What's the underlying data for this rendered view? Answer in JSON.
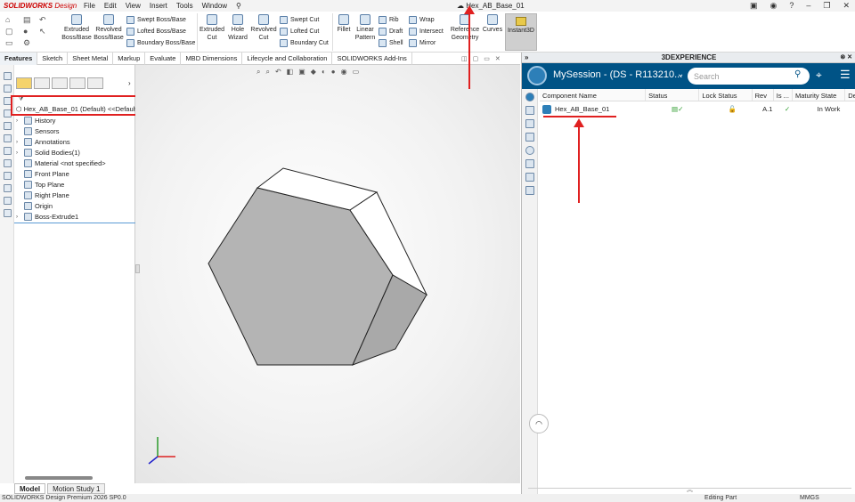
{
  "app": {
    "brand_bold": "SOLIDWORKS",
    "brand_light": "Design",
    "menus": [
      "File",
      "Edit",
      "View",
      "Insert",
      "Tools",
      "Window"
    ],
    "document_title": "Hex_AB_Base_01"
  },
  "commands": {
    "extruded_boss": "Extruded\nBoss/Base",
    "revolved_boss": "Revolved\nBoss/Base",
    "swept_boss": "Swept Boss/Base",
    "lofted_boss": "Lofted Boss/Base",
    "boundary_boss": "Boundary Boss/Base",
    "extruded_cut": "Extruded\nCut",
    "hole_wizard": "Hole\nWizard",
    "revolved_cut": "Revolved\nCut",
    "swept_cut": "Swept Cut",
    "lofted_cut": "Lofted Cut",
    "boundary_cut": "Boundary Cut",
    "fillet": "Fillet",
    "linear_pattern": "Linear\nPattern",
    "rib": "Rib",
    "draft": "Draft",
    "shell": "Shell",
    "wrap": "Wrap",
    "intersect": "Intersect",
    "mirror": "Mirror",
    "reference_geometry": "Reference\nGeometry",
    "curves": "Curves",
    "instant3d": "Instant3D"
  },
  "tabs": [
    "Features",
    "Sketch",
    "Sheet Metal",
    "Markup",
    "Evaluate",
    "MBD Dimensions",
    "Lifecycle and Collaboration",
    "SOLIDWORKS Add-Ins"
  ],
  "feature_tree": {
    "root": "Hex_AB_Base_01 (Default) <<Default>",
    "items": [
      {
        "label": "History",
        "expandable": true
      },
      {
        "label": "Sensors",
        "expandable": false
      },
      {
        "label": "Annotations",
        "expandable": true
      },
      {
        "label": "Solid Bodies(1)",
        "expandable": true
      },
      {
        "label": "Material <not specified>",
        "expandable": false
      },
      {
        "label": "Front Plane",
        "expandable": false
      },
      {
        "label": "Top Plane",
        "expandable": false
      },
      {
        "label": "Right Plane",
        "expandable": false
      },
      {
        "label": "Origin",
        "expandable": false
      },
      {
        "label": "Boss-Extrude1",
        "expandable": true
      }
    ]
  },
  "bottom_tabs": [
    "Model",
    "Motion Study 1"
  ],
  "status": {
    "left": "SOLIDWORKS Design Premium 2026 SP0.0",
    "mode": "Editing Part",
    "units": "MMGS"
  },
  "panel": {
    "title": "3DEXPERIENCE",
    "session_title": "MySession - (DS - R113210...",
    "search_placeholder": "Search",
    "columns": [
      "Component Name",
      "Status",
      "Lock Status",
      "Rev",
      "Is ...",
      "Maturity State",
      "De"
    ],
    "rows": [
      {
        "name": "Hex_AB_Base_01",
        "rev": "A.1",
        "maturity": "In Work"
      }
    ]
  },
  "colors": {
    "accent_red": "#e02020",
    "panel_blue": "#005386"
  }
}
